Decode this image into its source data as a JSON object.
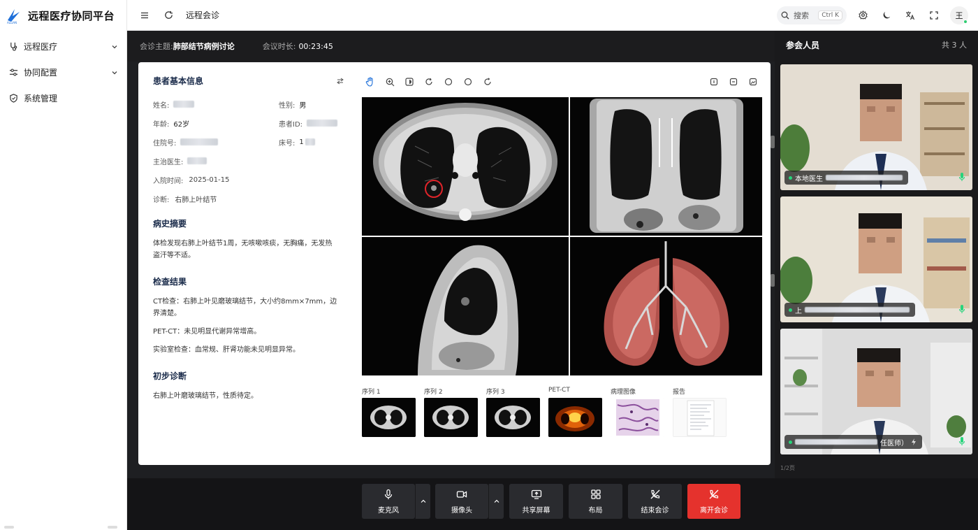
{
  "app": {
    "title": "远程医疗协同平台",
    "logo_text": "ALLIAN"
  },
  "sidebar": {
    "items": [
      {
        "label": "远程医疗",
        "icon": "stethoscope-icon",
        "expandable": true
      },
      {
        "label": "协同配置",
        "icon": "sliders-icon",
        "expandable": true
      },
      {
        "label": "系统管理",
        "icon": "shield-icon",
        "expandable": false
      }
    ]
  },
  "topbar": {
    "page_name": "远程会诊",
    "search_placeholder": "搜索",
    "search_shortcut": "Ctrl K",
    "avatar_text": "王"
  },
  "meeting": {
    "topic_label": "会诊主题:",
    "topic": "肺部结节病例讨论",
    "duration_label": "会议时长:",
    "duration": "00:23:45"
  },
  "patient": {
    "title": "患者基本信息",
    "name_label": "姓名:",
    "gender_label": "性别:",
    "gender": "男",
    "age_label": "年龄:",
    "age": "62岁",
    "id_label": "患者ID:",
    "inpatient_label": "住院号:",
    "bed_label": "床号:",
    "bed_partial": "1",
    "doctor_label": "主治医生:",
    "admit_label": "入院时间:",
    "admit_date": "2025-01-15",
    "diag_label": "诊断:",
    "diagnosis": "右肺上叶结节"
  },
  "history": {
    "title": "病史摘要",
    "text": "体检发现右肺上叶结节1周，无咳嗽咳痰，无胸痛，无发热盗汗等不适。"
  },
  "exam": {
    "title": "检查结果",
    "ct": "CT检查：右肺上叶见磨玻璃结节，大小约8mm×7mm，边界清楚。",
    "pet": "PET-CT：未见明显代谢异常增高。",
    "lab": "实验室检查：血常规、肝肾功能未见明显异常。"
  },
  "prelim": {
    "title": "初步诊断",
    "text": "右肺上叶磨玻璃结节，性质待定。"
  },
  "thumbnails": [
    {
      "label": "序列 1",
      "kind": "ct"
    },
    {
      "label": "序列 2",
      "kind": "ct"
    },
    {
      "label": "序列 3",
      "kind": "ct"
    },
    {
      "label": "PET-CT",
      "kind": "pet"
    },
    {
      "label": "病理图像",
      "kind": "pathology"
    },
    {
      "label": "报告",
      "kind": "report"
    }
  ],
  "participants": {
    "title": "参会人员",
    "count": "共 3 人",
    "people": [
      {
        "label": "本地医生"
      },
      {
        "label": "上"
      },
      {
        "label": "任医师）"
      }
    ],
    "footer": "1/2页"
  },
  "controls": {
    "mic": "麦克风",
    "camera": "摄像头",
    "share": "共享屏幕",
    "layout": "布局",
    "end": "结束会诊",
    "leave": "离开会诊"
  },
  "colors": {
    "accent_blue": "#1e6fd9",
    "leave_red": "#e5322d",
    "online_green": "#27d47b",
    "marker_red": "#e0242a"
  }
}
